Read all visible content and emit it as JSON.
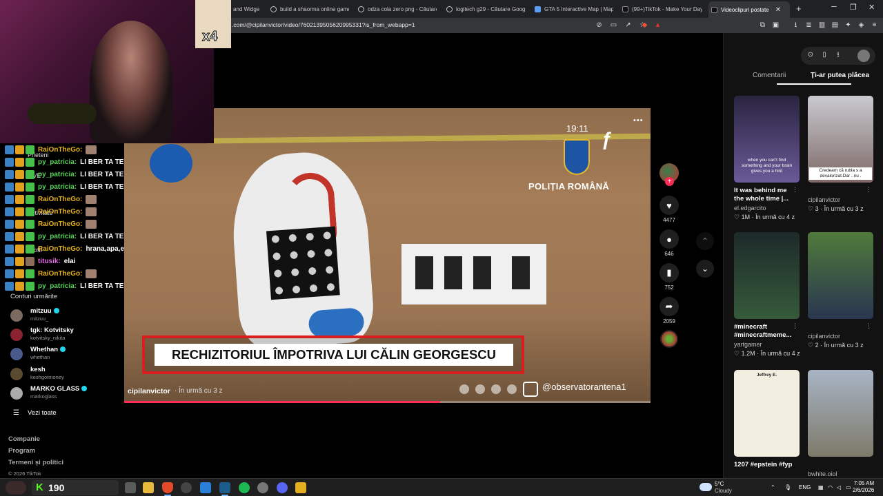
{
  "browser": {
    "tabs": [
      {
        "label": "and Widge"
      },
      {
        "label": "build a shaorma online game"
      },
      {
        "label": "odza cola zero png - Căutare"
      },
      {
        "label": "logitech g29 - Căutare Goog"
      },
      {
        "label": "GTA 5 Interactive Map | Map"
      },
      {
        "label": "(99+)TikTok - Make Your Day"
      },
      {
        "label": "Videoclipuri postate"
      }
    ],
    "url": ".com/@cipilanvictor/video/7602139505620995331?is_from_webapp=1"
  },
  "overlay": {
    "multiplier": "x4"
  },
  "chat": [
    {
      "user": "RaiOnTheGo:",
      "color": "#e6b31e",
      "text": "",
      "emote": true
    },
    {
      "user": "py_patricia:",
      "color": "#5bd35b",
      "text": "LI BER TA TE",
      "emote": false
    },
    {
      "user": "py_patricia:",
      "color": "#5bd35b",
      "text": "LI BER TA TE",
      "emote": false
    },
    {
      "user": "py_patricia:",
      "color": "#5bd35b",
      "text": "LI BER TA TE",
      "emote": false
    },
    {
      "user": "RaiOnTheGo:",
      "color": "#e6b31e",
      "text": "",
      "emote": true
    },
    {
      "user": "RaiOnTheGo:",
      "color": "#e6b31e",
      "text": "",
      "emote": true
    },
    {
      "user": "RaiOnTheGo:",
      "color": "#e6b31e",
      "text": "",
      "emote": true
    },
    {
      "user": "py_patricia:",
      "color": "#5bd35b",
      "text": "LI BER TA TE",
      "emote": false
    },
    {
      "user": "RaiOnTheGo:",
      "color": "#e6b31e",
      "text": "hrana,apa,energie",
      "emote": false
    },
    {
      "user": "titusik:",
      "color": "#e06be0",
      "text": "elai",
      "emote": false
    },
    {
      "user": "RaiOnTheGo:",
      "color": "#e6b31e",
      "text": "",
      "emote": true
    },
    {
      "user": "py_patricia:",
      "color": "#5bd35b",
      "text": "LI BER TA TE",
      "emote": false
    }
  ],
  "sidebar_faint": {
    "prieteni": "Prieteni",
    "live": "LIVE",
    "activitate": "Activitate",
    "profil": "Profil"
  },
  "following": {
    "title": "Conturi urmărite",
    "accounts": [
      {
        "name": "mitzuu",
        "handle": "mitzuu_",
        "verified": true,
        "avatar_color": "#7a6a60"
      },
      {
        "name": "tgk: Kotvitsky",
        "handle": "kotvitsky_nikita",
        "verified": false,
        "avatar_color": "#8a2230"
      },
      {
        "name": "Whethan",
        "handle": "whethan",
        "verified": true,
        "avatar_color": "#4a5a8a"
      },
      {
        "name": "kesh",
        "handle": "keshgotmoney",
        "verified": false,
        "avatar_color": "#5a4a30"
      },
      {
        "name": "MARKO GLASS",
        "handle": "markoglass",
        "verified": true,
        "avatar_color": "#aaaaaa"
      }
    ],
    "see_all": "Vezi toate"
  },
  "footer": {
    "companie": "Companie",
    "program": "Program",
    "termeni": "Termeni și politici",
    "copyright": "© 2026 TikTok"
  },
  "video": {
    "clock": "19:11",
    "police_text": "POLIȚIA ROMÂNĂ",
    "banner": "RECHIZITORIUL ÎMPOTRIVA LUI CĂLIN GEORGESCU",
    "author": "cipilanvictor",
    "posted": "· În urmă cu 3 z",
    "handle": "@observatorantena1",
    "progress": 0.6
  },
  "actions": {
    "likes": "4477",
    "comments": "646",
    "saves": "752",
    "shares": "2059"
  },
  "right_panel": {
    "tab_comments": "Comentarii",
    "tab_suggestions": "Ți-ar putea plăcea",
    "cards": [
      {
        "desc": "It was behind me the whole time |...",
        "author": "el.edgarcito",
        "stats": "♡ 1M · În urmă cu 4 z",
        "caption": "when you can't find something and your brain gives you a hint",
        "overlay": ""
      },
      {
        "desc": "",
        "author": "cipilanvictor",
        "stats": "♡ 3 · În urmă cu 3 z",
        "caption": "",
        "overlay": "Credeam că rubla s a devalorizat.Dar ..nu ."
      },
      {
        "desc": "#minecraft #minecraftmeme...",
        "author": "yartgamer",
        "stats": "♡ 1.2M · În urmă cu 4 z",
        "caption": "",
        "overlay": ""
      },
      {
        "desc": "",
        "author": "cipilanvictor",
        "stats": "♡ 2 · În urmă cu 3 z",
        "caption": "",
        "overlay": ""
      },
      {
        "desc": "1207 #epstein #fyp",
        "author": "",
        "stats": "",
        "caption": "Jeffrey E.",
        "overlay": ""
      },
      {
        "desc": "",
        "author": "bwhite.oiol",
        "stats": "",
        "caption": "",
        "overlay": ""
      }
    ]
  },
  "taskbar": {
    "kick_count": "190",
    "kick_k": "K",
    "temp": "5°C",
    "weather": "Cloudy",
    "lang": "ENG",
    "time": "7:05 AM",
    "date": "2/6/2026"
  }
}
